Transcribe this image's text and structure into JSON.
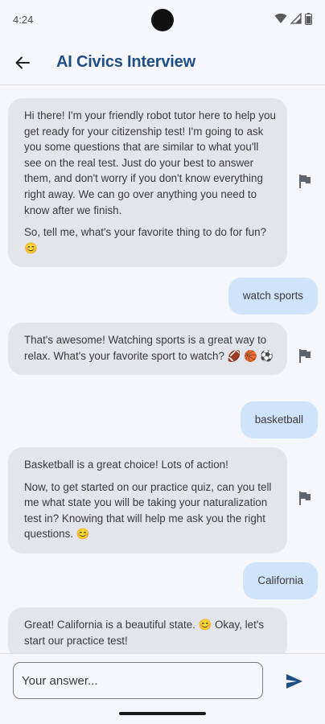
{
  "status_bar": {
    "time": "4:24"
  },
  "app_bar": {
    "title": "AI Civics Interview"
  },
  "messages": [
    {
      "role": "bot",
      "paragraphs": [
        "Hi there! I'm your friendly robot tutor here to help you get ready for your citizenship test!  I'm going to ask you some questions that are similar to what you'll see on the real test.  Just do your best to answer them, and don't worry if you don't know everything right away. We can go over anything you need to know after we finish.",
        "So, tell me, what's your favorite thing to do for fun? 😊"
      ]
    },
    {
      "role": "user",
      "text": "watch sports"
    },
    {
      "role": "bot",
      "paragraphs": [
        "That's awesome!  Watching sports is a great way to relax.  What's your favorite sport to watch? 🏈 🏀 ⚽"
      ]
    },
    {
      "role": "user",
      "text": "basketball"
    },
    {
      "role": "bot",
      "paragraphs": [
        "Basketball is a great choice!  Lots of action!",
        "Now, to get started on our practice quiz, can you tell me what state you will be taking your naturalization test in?  Knowing that will help me ask you the right questions.  😊"
      ]
    },
    {
      "role": "user",
      "text": "California"
    },
    {
      "role": "bot",
      "paragraphs": [
        "Great! California is a beautiful state. 😊  Okay, let's start our practice test!"
      ]
    }
  ],
  "input": {
    "placeholder": "Your answer...",
    "value": ""
  },
  "icons": {
    "back": "arrow-back-icon",
    "flag": "flag-icon",
    "send": "send-icon",
    "wifi": "wifi-icon",
    "signal": "cell-signal-icon",
    "battery": "battery-icon"
  },
  "colors": {
    "title": "#1f4e84",
    "bot_bubble": "#e4e5eb",
    "user_bubble": "#cfe4fb",
    "send_icon": "#1f4e84",
    "background": "#f6f7fc"
  }
}
